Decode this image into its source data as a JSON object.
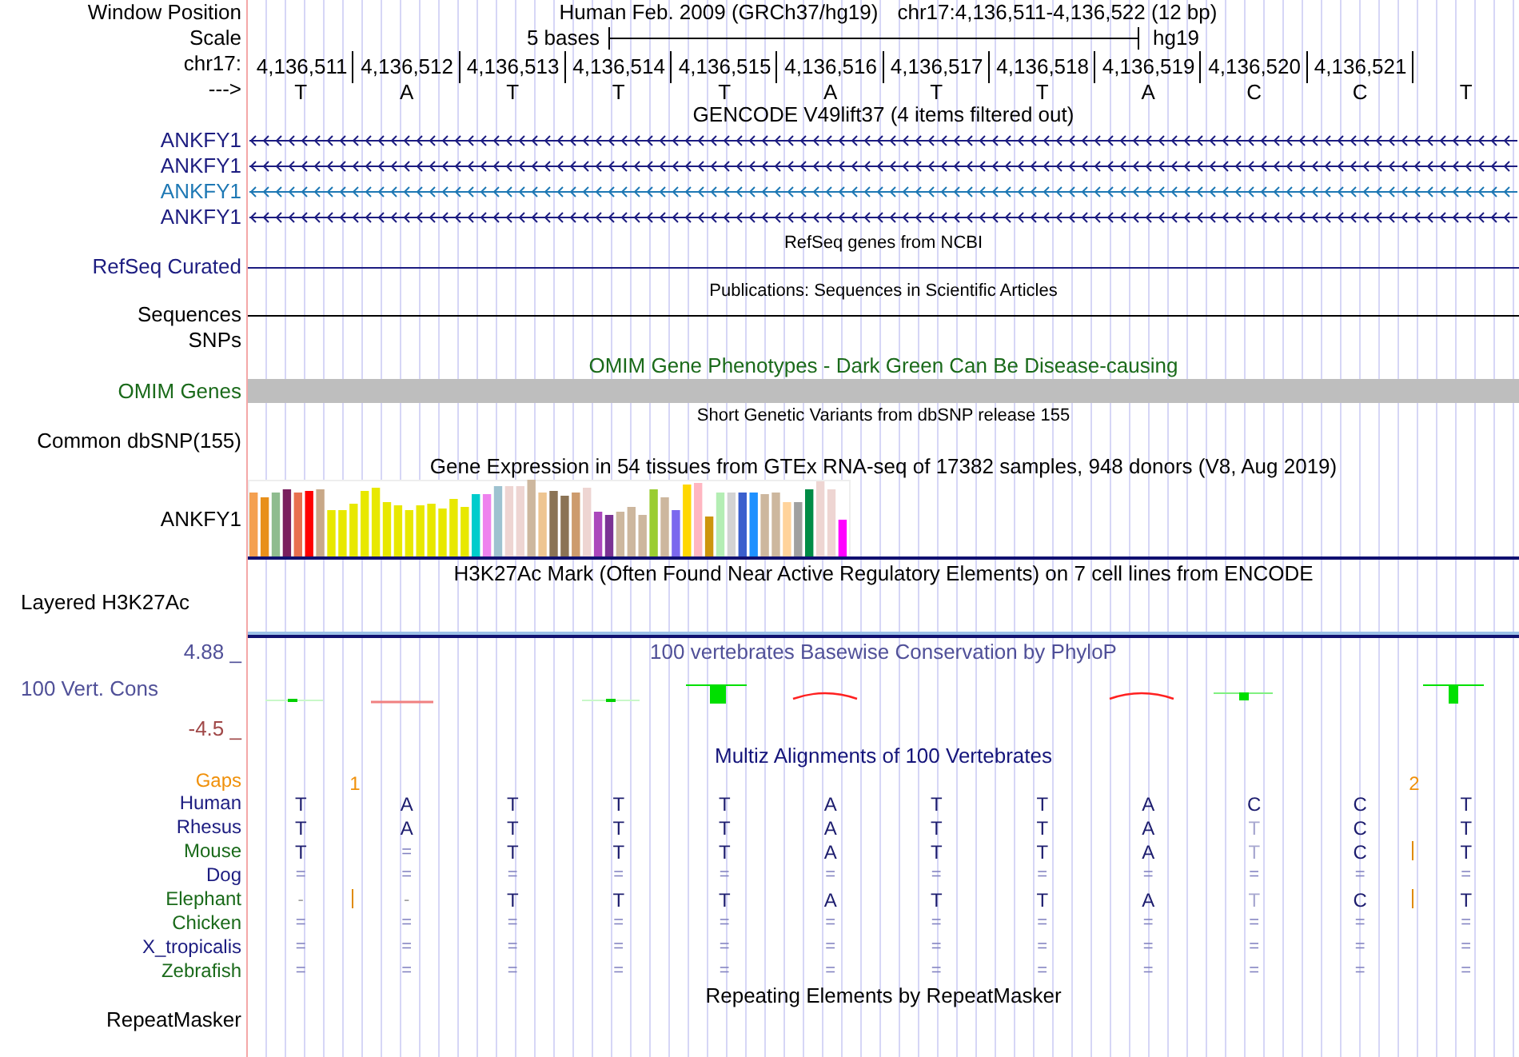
{
  "header": {
    "label": "Window Position",
    "assembly": "Human Feb. 2009 (GRCh37/hg19)",
    "position": "chr17:4,136,511-4,136,522 (12 bp)"
  },
  "scale": {
    "label": "Scale",
    "length": "5 bases",
    "assembly": "hg19"
  },
  "ruler": {
    "label": "chr17:",
    "positions": [
      "4,136,511",
      "4,136,512",
      "4,136,513",
      "4,136,514",
      "4,136,515",
      "4,136,516",
      "4,136,517",
      "4,136,518",
      "4,136,519",
      "4,136,520",
      "4,136,521"
    ]
  },
  "sequence": {
    "label": "--->",
    "bases": [
      "T",
      "A",
      "T",
      "T",
      "T",
      "A",
      "T",
      "T",
      "A",
      "C",
      "C",
      "T"
    ]
  },
  "gencode": {
    "title": "GENCODE V49lift37 (4 items filtered out)",
    "transcripts": [
      {
        "name": "ANKFY1",
        "color": "#1c1c80"
      },
      {
        "name": "ANKFY1",
        "color": "#1c1c80"
      },
      {
        "name": "ANKFY1",
        "color": "#1e78b4"
      },
      {
        "name": "ANKFY1",
        "color": "#1c1c80"
      }
    ]
  },
  "refseq": {
    "title": "RefSeq genes from NCBI",
    "label": "RefSeq Curated"
  },
  "publications": {
    "title": "Publications: Sequences in Scientific Articles",
    "label": "Sequences"
  },
  "snps": {
    "label": "SNPs"
  },
  "omim": {
    "title": "OMIM Gene Phenotypes - Dark Green Can Be Disease-causing",
    "label": "OMIM Genes"
  },
  "dbsnp": {
    "title": "Short Genetic Variants from dbSNP release 155",
    "label": "Common dbSNP(155)"
  },
  "gtex": {
    "title": "Gene Expression in 54 tissues from GTEx RNA-seq of 17382 samples, 948 donors (V8, Aug 2019)",
    "label": "ANKFY1"
  },
  "h3k27ac": {
    "title": "H3K27Ac Mark (Often Found Near Active Regulatory Elements) on 7 cell lines from ENCODE",
    "label": "Layered H3K27Ac"
  },
  "conservation": {
    "title": "100 vertebrates Basewise Conservation by PhyloP",
    "label": "100 Vert. Cons",
    "max": "4.88 _",
    "min": "-4.5 _"
  },
  "multiz": {
    "title": "Multiz Alignments of 100 Vertebrates",
    "gaps": {
      "label": "Gaps",
      "cells": [
        {
          "insertion": true,
          "count": "1"
        },
        {
          "insertion": false
        },
        {
          "insertion": false
        },
        {
          "insertion": false
        },
        {
          "insertion": false
        },
        {
          "insertion": false
        },
        {
          "insertion": false
        },
        {
          "insertion": false
        },
        {
          "insertion": false
        },
        {
          "insertion": false
        },
        {
          "insertion": true,
          "count": "2"
        },
        {
          "insertion": false
        }
      ]
    },
    "species": [
      {
        "name": "Human",
        "color": "#1c1c80",
        "cells": [
          {
            "text": "T",
            "kind": "base",
            "insertion_after": false
          },
          {
            "text": "A",
            "kind": "base",
            "insertion_after": false
          },
          {
            "text": "T",
            "kind": "base",
            "insertion_after": false
          },
          {
            "text": "T",
            "kind": "base",
            "insertion_after": false
          },
          {
            "text": "T",
            "kind": "base",
            "insertion_after": false
          },
          {
            "text": "A",
            "kind": "base",
            "insertion_after": false
          },
          {
            "text": "T",
            "kind": "base",
            "insertion_after": false
          },
          {
            "text": "T",
            "kind": "base",
            "insertion_after": false
          },
          {
            "text": "A",
            "kind": "base",
            "insertion_after": false
          },
          {
            "text": "C",
            "kind": "base",
            "insertion_after": false
          },
          {
            "text": "C",
            "kind": "base",
            "insertion_after": false
          },
          {
            "text": "T",
            "kind": "base",
            "insertion_after": false
          }
        ]
      },
      {
        "name": "Rhesus",
        "color": "#1c1c80",
        "cells": [
          {
            "text": "T",
            "kind": "base",
            "insertion_after": false
          },
          {
            "text": "A",
            "kind": "base",
            "insertion_after": false
          },
          {
            "text": "T",
            "kind": "base",
            "insertion_after": false
          },
          {
            "text": "T",
            "kind": "base",
            "insertion_after": false
          },
          {
            "text": "T",
            "kind": "base",
            "insertion_after": false
          },
          {
            "text": "A",
            "kind": "base",
            "insertion_after": false
          },
          {
            "text": "T",
            "kind": "base",
            "insertion_after": false
          },
          {
            "text": "T",
            "kind": "base",
            "insertion_after": false
          },
          {
            "text": "A",
            "kind": "base",
            "insertion_after": false
          },
          {
            "text": "T",
            "kind": "mismatch",
            "insertion_after": false
          },
          {
            "text": "C",
            "kind": "base",
            "insertion_after": false
          },
          {
            "text": "T",
            "kind": "base",
            "insertion_after": false
          }
        ]
      },
      {
        "name": "Mouse",
        "color": "#1a6a1a",
        "cells": [
          {
            "text": "T",
            "kind": "base",
            "insertion_after": false
          },
          {
            "text": "=",
            "kind": "missing",
            "insertion_after": false
          },
          {
            "text": "T",
            "kind": "base",
            "insertion_after": false
          },
          {
            "text": "T",
            "kind": "base",
            "insertion_after": false
          },
          {
            "text": "T",
            "kind": "base",
            "insertion_after": false
          },
          {
            "text": "A",
            "kind": "base",
            "insertion_after": false
          },
          {
            "text": "T",
            "kind": "base",
            "insertion_after": false
          },
          {
            "text": "T",
            "kind": "base",
            "insertion_after": false
          },
          {
            "text": "A",
            "kind": "base",
            "insertion_after": false
          },
          {
            "text": "T",
            "kind": "mismatch",
            "insertion_after": false
          },
          {
            "text": "C",
            "kind": "base",
            "insertion_after": true
          },
          {
            "text": "T",
            "kind": "base",
            "insertion_after": false
          }
        ]
      },
      {
        "name": "Dog",
        "color": "#1c1c80",
        "cells": [
          {
            "text": "=",
            "kind": "missing",
            "insertion_after": false
          },
          {
            "text": "=",
            "kind": "missing",
            "insertion_after": false
          },
          {
            "text": "=",
            "kind": "missing",
            "insertion_after": false
          },
          {
            "text": "=",
            "kind": "missing",
            "insertion_after": false
          },
          {
            "text": "=",
            "kind": "missing",
            "insertion_after": false
          },
          {
            "text": "=",
            "kind": "missing",
            "insertion_after": false
          },
          {
            "text": "=",
            "kind": "missing",
            "insertion_after": false
          },
          {
            "text": "=",
            "kind": "missing",
            "insertion_after": false
          },
          {
            "text": "=",
            "kind": "missing",
            "insertion_after": false
          },
          {
            "text": "=",
            "kind": "missing",
            "insertion_after": false
          },
          {
            "text": "=",
            "kind": "missing",
            "insertion_after": false
          },
          {
            "text": "=",
            "kind": "missing",
            "insertion_after": false
          }
        ]
      },
      {
        "name": "Elephant",
        "color": "#1a6a1a",
        "cells": [
          {
            "text": "-",
            "kind": "gap",
            "insertion_after": true
          },
          {
            "text": "-",
            "kind": "gap",
            "insertion_after": false
          },
          {
            "text": "T",
            "kind": "base",
            "insertion_after": false
          },
          {
            "text": "T",
            "kind": "base",
            "insertion_after": false
          },
          {
            "text": "T",
            "kind": "base",
            "insertion_after": false
          },
          {
            "text": "A",
            "kind": "base",
            "insertion_after": false
          },
          {
            "text": "T",
            "kind": "base",
            "insertion_after": false
          },
          {
            "text": "T",
            "kind": "base",
            "insertion_after": false
          },
          {
            "text": "A",
            "kind": "base",
            "insertion_after": false
          },
          {
            "text": "T",
            "kind": "mismatch",
            "insertion_after": false
          },
          {
            "text": "C",
            "kind": "base",
            "insertion_after": true
          },
          {
            "text": "T",
            "kind": "base",
            "insertion_after": false
          }
        ]
      },
      {
        "name": "Chicken",
        "color": "#1a6a1a",
        "cells": [
          {
            "text": "=",
            "kind": "missing",
            "insertion_after": false
          },
          {
            "text": "=",
            "kind": "missing",
            "insertion_after": false
          },
          {
            "text": "=",
            "kind": "missing",
            "insertion_after": false
          },
          {
            "text": "=",
            "kind": "missing",
            "insertion_after": false
          },
          {
            "text": "=",
            "kind": "missing",
            "insertion_after": false
          },
          {
            "text": "=",
            "kind": "missing",
            "insertion_after": false
          },
          {
            "text": "=",
            "kind": "missing",
            "insertion_after": false
          },
          {
            "text": "=",
            "kind": "missing",
            "insertion_after": false
          },
          {
            "text": "=",
            "kind": "missing",
            "insertion_after": false
          },
          {
            "text": "=",
            "kind": "missing",
            "insertion_after": false
          },
          {
            "text": "=",
            "kind": "missing",
            "insertion_after": false
          },
          {
            "text": "=",
            "kind": "missing",
            "insertion_after": false
          }
        ]
      },
      {
        "name": "X_tropicalis",
        "color": "#1c1c80",
        "cells": [
          {
            "text": "=",
            "kind": "missing",
            "insertion_after": false
          },
          {
            "text": "=",
            "kind": "missing",
            "insertion_after": false
          },
          {
            "text": "=",
            "kind": "missing",
            "insertion_after": false
          },
          {
            "text": "=",
            "kind": "missing",
            "insertion_after": false
          },
          {
            "text": "=",
            "kind": "missing",
            "insertion_after": false
          },
          {
            "text": "=",
            "kind": "missing",
            "insertion_after": false
          },
          {
            "text": "=",
            "kind": "missing",
            "insertion_after": false
          },
          {
            "text": "=",
            "kind": "missing",
            "insertion_after": false
          },
          {
            "text": "=",
            "kind": "missing",
            "insertion_after": false
          },
          {
            "text": "=",
            "kind": "missing",
            "insertion_after": false
          },
          {
            "text": "=",
            "kind": "missing",
            "insertion_after": false
          },
          {
            "text": "=",
            "kind": "missing",
            "insertion_after": false
          }
        ]
      },
      {
        "name": "Zebrafish",
        "color": "#1a6a1a",
        "cells": [
          {
            "text": "=",
            "kind": "missing",
            "insertion_after": false
          },
          {
            "text": "=",
            "kind": "missing",
            "insertion_after": false
          },
          {
            "text": "=",
            "kind": "missing",
            "insertion_after": false
          },
          {
            "text": "=",
            "kind": "missing",
            "insertion_after": false
          },
          {
            "text": "=",
            "kind": "missing",
            "insertion_after": false
          },
          {
            "text": "=",
            "kind": "missing",
            "insertion_after": false
          },
          {
            "text": "=",
            "kind": "missing",
            "insertion_after": false
          },
          {
            "text": "=",
            "kind": "missing",
            "insertion_after": false
          },
          {
            "text": "=",
            "kind": "missing",
            "insertion_after": false
          },
          {
            "text": "=",
            "kind": "missing",
            "insertion_after": false
          },
          {
            "text": "=",
            "kind": "missing",
            "insertion_after": false
          },
          {
            "text": "=",
            "kind": "missing",
            "insertion_after": false
          }
        ]
      }
    ]
  },
  "repeatmasker": {
    "title": "Repeating Elements by RepeatMasker",
    "label": "RepeatMasker"
  }
}
